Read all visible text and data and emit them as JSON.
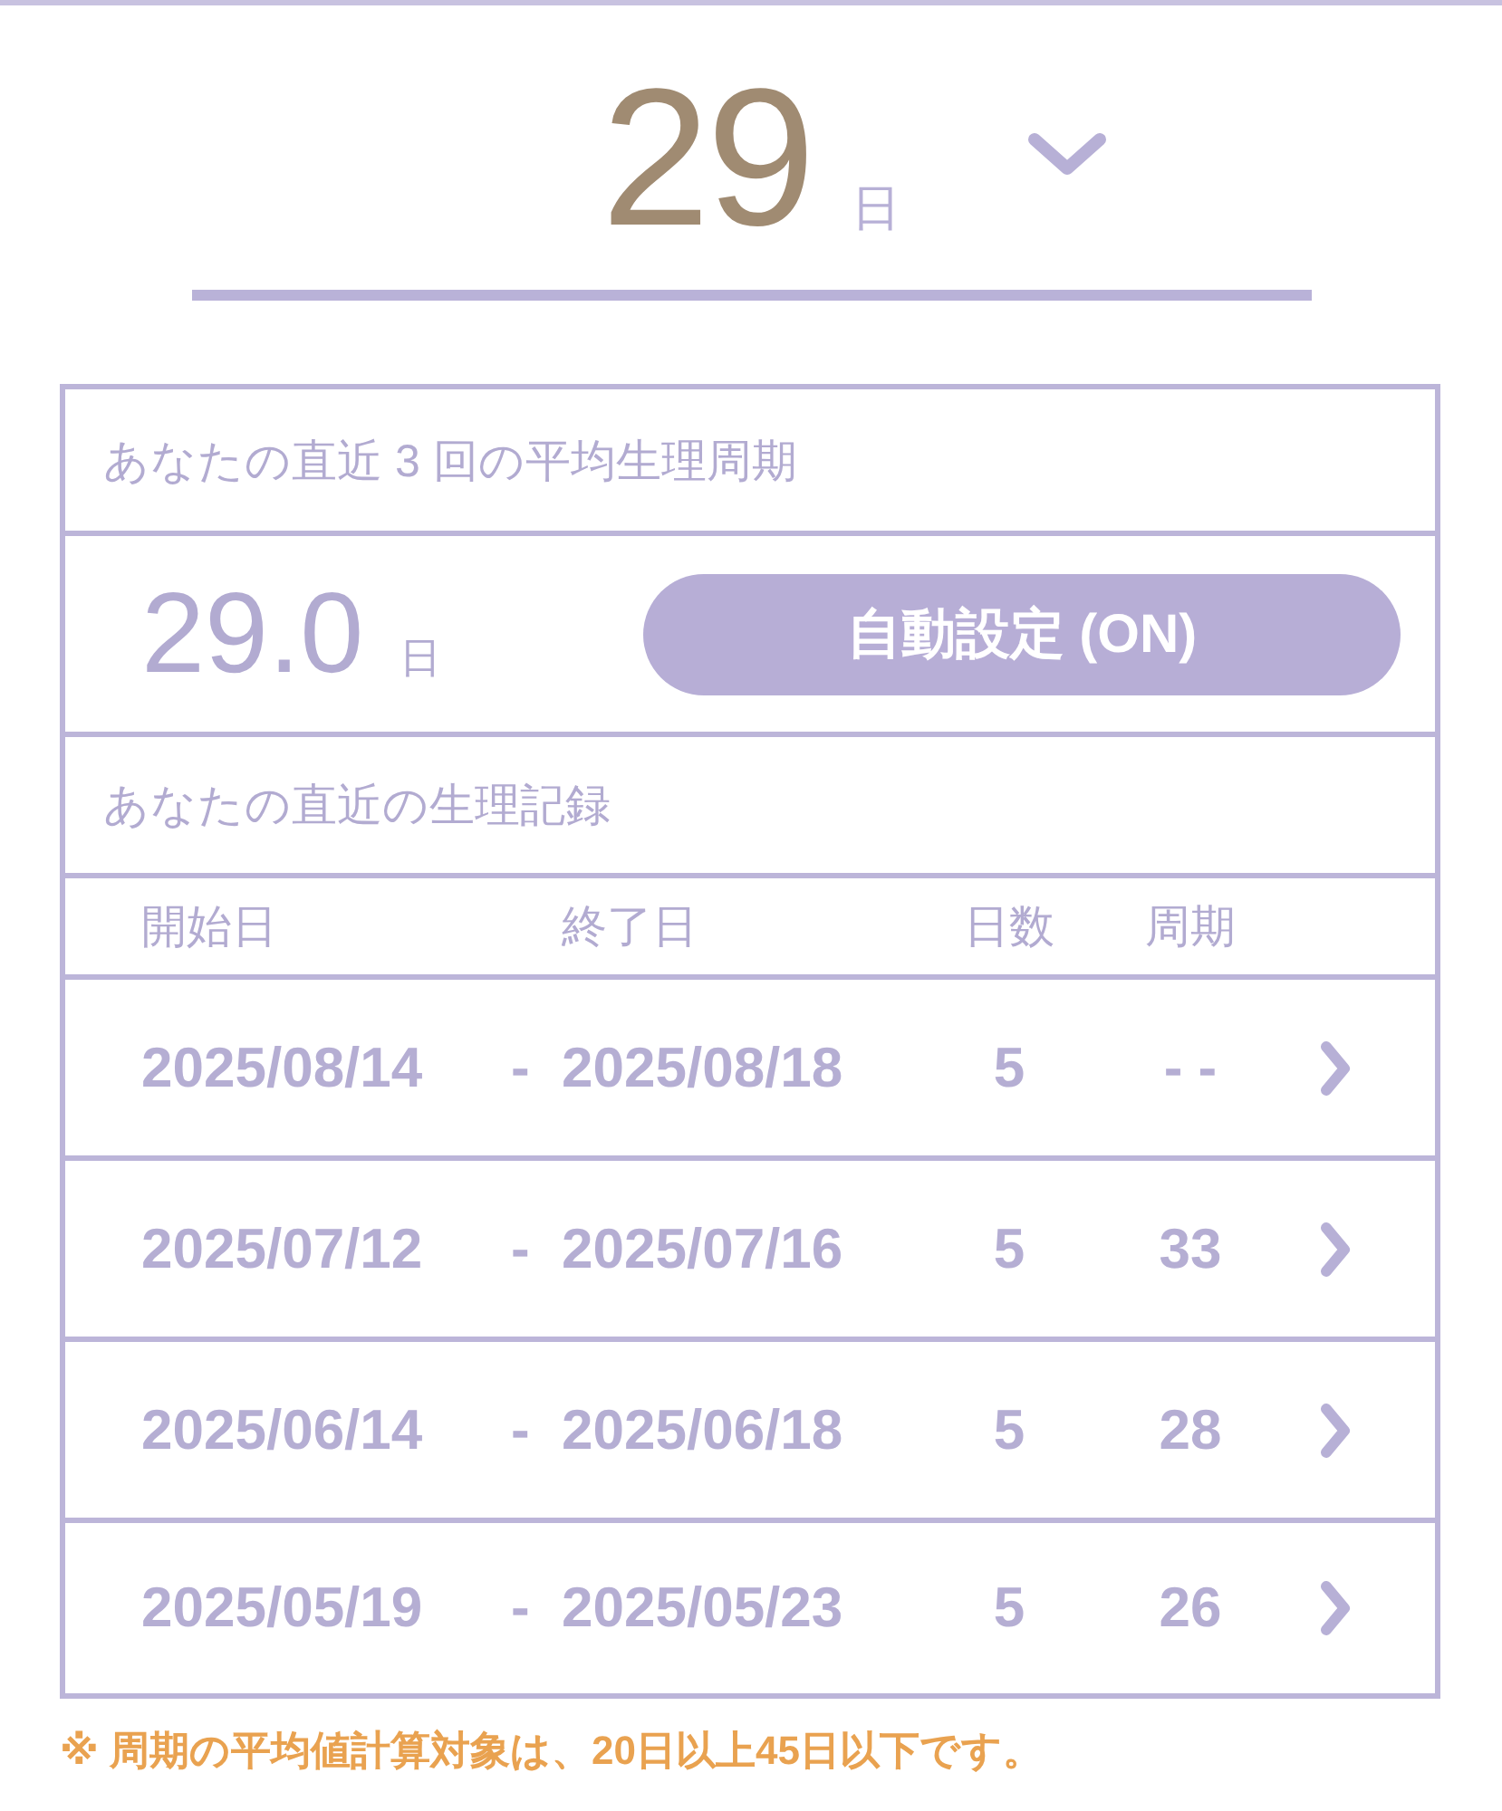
{
  "day_select": {
    "value": "29",
    "unit": "日"
  },
  "average": {
    "title": "あなたの直近 3 回の平均生理周期",
    "value": "29.0",
    "unit": "日",
    "auto_button": "自動設定 (ON)"
  },
  "records": {
    "title": "あなたの直近の生理記録",
    "columns": [
      "開始日",
      "終了日",
      "日数",
      "周期"
    ],
    "rows": [
      {
        "start": "2025/08/14",
        "separator": "-",
        "end": "2025/08/18",
        "days": "5",
        "cycle": "- -"
      },
      {
        "start": "2025/07/12",
        "separator": "-",
        "end": "2025/07/16",
        "days": "5",
        "cycle": "33"
      },
      {
        "start": "2025/06/14",
        "separator": "-",
        "end": "2025/06/18",
        "days": "5",
        "cycle": "28"
      },
      {
        "start": "2025/05/19",
        "separator": "-",
        "end": "2025/05/23",
        "days": "5",
        "cycle": "26"
      }
    ]
  },
  "note": "※ 周期の平均値計算対象は、20日以上45日以下です。"
}
